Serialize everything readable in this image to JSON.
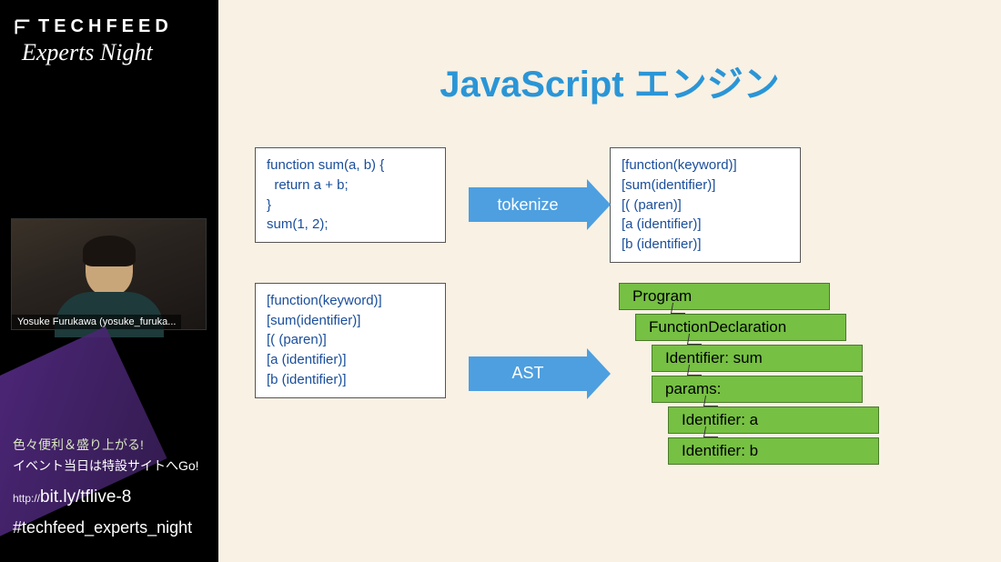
{
  "sidebar": {
    "brand": "TECHFEED",
    "tagline": "Experts Night",
    "webcam_label": "Yosuke Furukawa (yosuke_furuka...",
    "promo_line1": "色々便利＆盛り上がる!",
    "promo_line2": "イベント当日は特設サイトへGo!",
    "url_proto": "http://",
    "url_slug": "bit.ly/tflive-8",
    "hashtag": "#techfeed_experts_night"
  },
  "slide": {
    "title": "JavaScript エンジン",
    "source_code": [
      "function sum(a, b) {",
      "  return a + b;",
      "}",
      "",
      "sum(1, 2);"
    ],
    "arrow1_label": "tokenize",
    "tokens": [
      "[function(keyword)]",
      "[sum(identifier)]",
      "[( (paren)]",
      "[a (identifier)]",
      "[b (identifier)]"
    ],
    "arrow2_label": "AST",
    "ast_nodes": [
      {
        "label": "Program",
        "indent": 0
      },
      {
        "label": "FunctionDeclaration",
        "indent": 1
      },
      {
        "label": "Identifier: sum",
        "indent": 2
      },
      {
        "label": "params:",
        "indent": 2
      },
      {
        "label": "Identifier: a",
        "indent": 3
      },
      {
        "label": "Identifier: b",
        "indent": 3
      }
    ]
  }
}
